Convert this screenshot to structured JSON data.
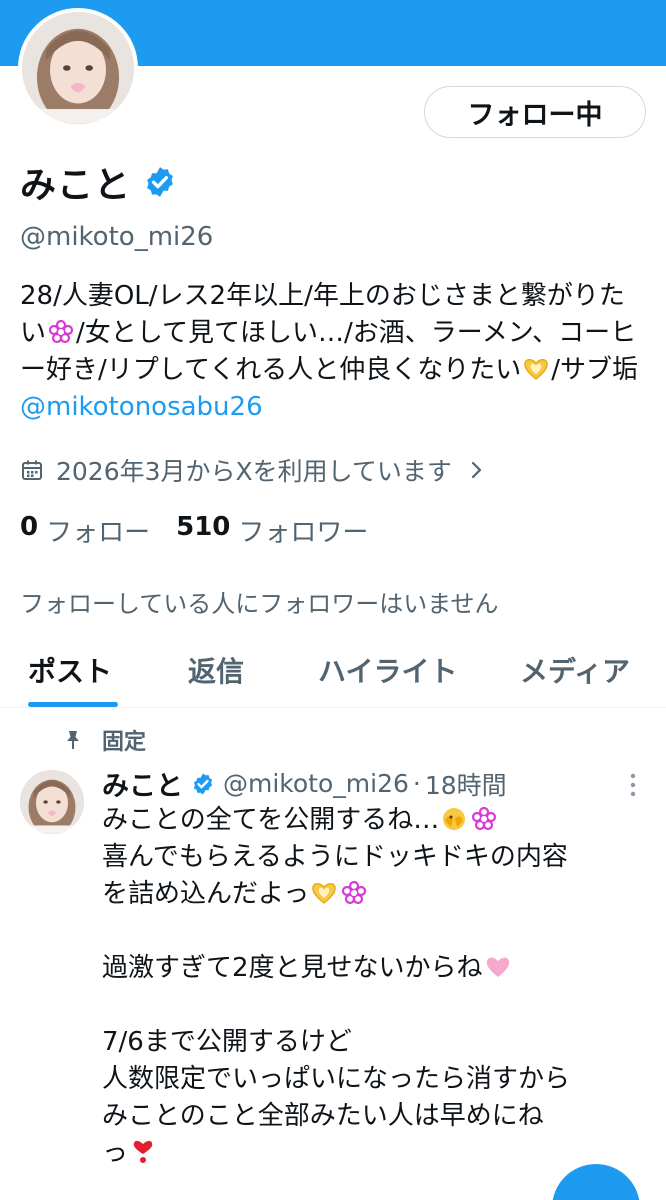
{
  "profile": {
    "name": "みこと",
    "handle": "@mikoto_mi26",
    "follow_button": "フォロー中",
    "bio": {
      "part1": "28/人妻OL/レス2年以上/年上のおじさまと繋がりたい",
      "part2": "/女として見てほしい…/お酒、ラーメン、コーヒー好き/リプしてくれる人と仲良くなりたい",
      "part3": "/サブ垢",
      "mention": "@mikotonosabu26"
    },
    "joined": "2026年3月からXを利用しています",
    "following_count": "0",
    "following_label": "フォロー",
    "followers_count": "510",
    "followers_label": "フォロワー",
    "mutual_notice": "フォローしている人にフォロワーはいません"
  },
  "tabs": [
    {
      "label": "ポスト"
    },
    {
      "label": "返信"
    },
    {
      "label": "ハイライト"
    },
    {
      "label": "メディア"
    }
  ],
  "pinned_post": {
    "pinned_label": "固定",
    "author": "みこと",
    "handle": "@mikoto_mi26",
    "time": "18時間",
    "separator": "·",
    "lines": {
      "l1": "みことの全てを公開するね…",
      "l2": "喜んでもらえるようにドッキドキの内容",
      "l3": "を詰め込んだよっ",
      "l4": "",
      "l5": "過激すぎて2度と見せないからね",
      "l6": "",
      "l7": "7/6まで公開するけど",
      "l8": "人数限定でいっぱいになったら消すから",
      "l9": "みことのこと全部みたい人は早めにね",
      "l10": "っ"
    }
  },
  "colors": {
    "accent": "#1d9bf0",
    "text": "#0f1419",
    "secondary": "#536471",
    "border": "#cfd9de"
  },
  "icons": {
    "verified": "verified-badge-icon",
    "calendar": "calendar-icon",
    "chevron": "chevron-right-icon",
    "pin": "pin-icon",
    "more": "more-vertical-icon",
    "heart_hands": "heart-hands-emoji",
    "flower": "white-flower-emoji",
    "peek": "face-peeking-emoji",
    "pink_heart": "pink-heart-emoji",
    "red_heart": "heart-exclamation-emoji"
  }
}
